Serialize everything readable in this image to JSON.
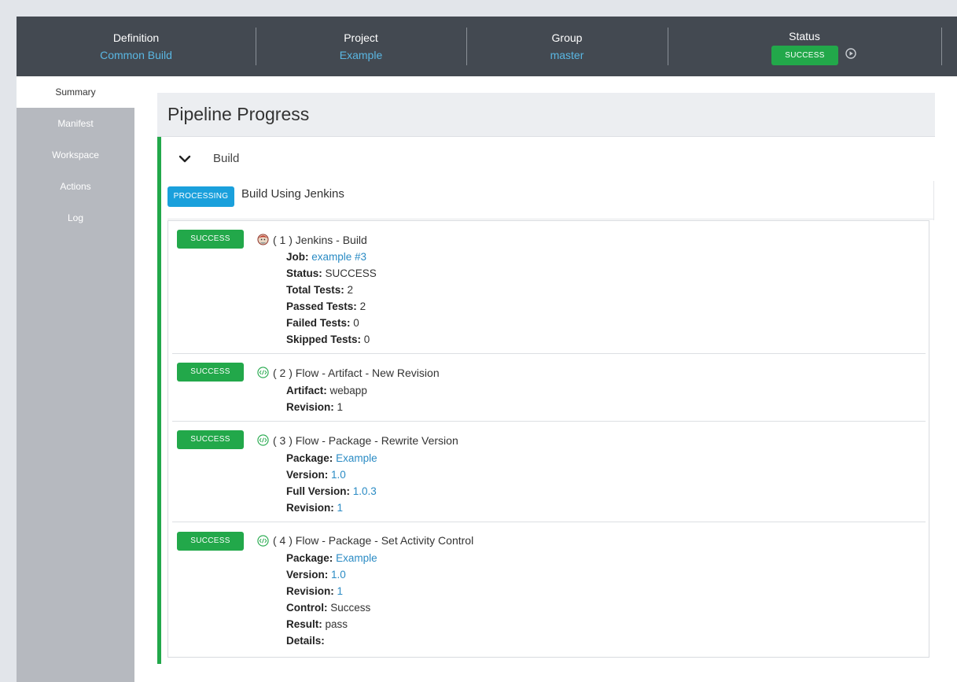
{
  "header": {
    "definition": {
      "label": "Definition",
      "value": "Common Build"
    },
    "project": {
      "label": "Project",
      "value": "Example"
    },
    "group": {
      "label": "Group",
      "value": "master"
    },
    "status": {
      "label": "Status",
      "value": "SUCCESS"
    }
  },
  "sidebar": {
    "items": [
      {
        "label": "Summary",
        "active": true
      },
      {
        "label": "Manifest"
      },
      {
        "label": "Workspace"
      },
      {
        "label": "Actions"
      },
      {
        "label": "Log"
      }
    ]
  },
  "main": {
    "title": "Pipeline Progress",
    "phase": "Build",
    "stage": {
      "badge": "PROCESSING",
      "title": "Build Using Jenkins"
    },
    "tasks": [
      {
        "badge": "SUCCESS",
        "icon": "jenkins-icon",
        "title": "( 1 ) Jenkins - Build",
        "fields": [
          {
            "key": "Job:",
            "value": "example #3",
            "link": true
          },
          {
            "key": "Status:",
            "value": "SUCCESS"
          },
          {
            "key": "Total Tests:",
            "value": "2"
          },
          {
            "key": "Passed Tests:",
            "value": "2"
          },
          {
            "key": "Failed Tests:",
            "value": "0"
          },
          {
            "key": "Skipped Tests:",
            "value": "0"
          }
        ]
      },
      {
        "badge": "SUCCESS",
        "icon": "flow-icon",
        "title": "( 2 ) Flow - Artifact - New Revision",
        "fields": [
          {
            "key": "Artifact:",
            "value": "webapp"
          },
          {
            "key": "Revision:",
            "value": "1"
          }
        ]
      },
      {
        "badge": "SUCCESS",
        "icon": "flow-icon",
        "title": "( 3 ) Flow - Package - Rewrite Version",
        "fields": [
          {
            "key": "Package:",
            "value": "Example",
            "link": true
          },
          {
            "key": "Version:",
            "value": "1.0",
            "link": true
          },
          {
            "key": "Full Version:",
            "value": "1.0.3",
            "link": true
          },
          {
            "key": "Revision:",
            "value": "1",
            "link": true
          }
        ]
      },
      {
        "badge": "SUCCESS",
        "icon": "flow-icon",
        "title": "( 4 ) Flow - Package - Set Activity Control",
        "fields": [
          {
            "key": "Package:",
            "value": "Example",
            "link": true
          },
          {
            "key": "Version:",
            "value": "1.0",
            "link": true
          },
          {
            "key": "Revision:",
            "value": "1",
            "link": true
          },
          {
            "key": "Control:",
            "value": "Success"
          },
          {
            "key": "Result:",
            "value": "pass"
          },
          {
            "key": "Details:",
            "value": ""
          }
        ]
      }
    ]
  },
  "colors": {
    "header_bg": "#434951",
    "accent_link": "#5ab7e3",
    "success": "#22a84a",
    "processing": "#1aa0dc",
    "sidebar_bg": "#b6b9bf"
  }
}
